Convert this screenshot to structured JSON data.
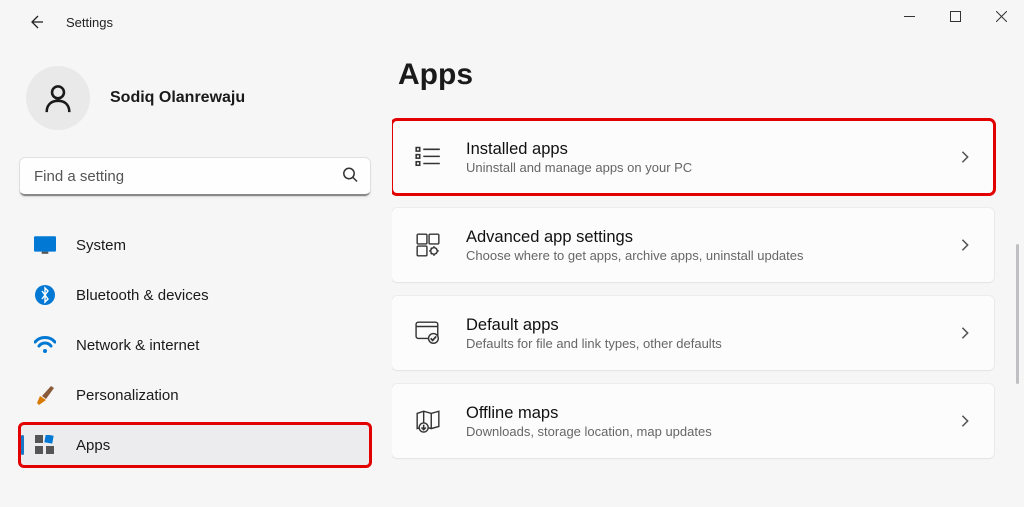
{
  "window": {
    "title": "Settings"
  },
  "profile": {
    "name": "Sodiq Olanrewaju"
  },
  "search": {
    "placeholder": "Find a setting"
  },
  "sidebar": {
    "items": [
      {
        "id": "system",
        "label": "System",
        "active": false,
        "highlight": false
      },
      {
        "id": "bluetooth",
        "label": "Bluetooth & devices",
        "active": false,
        "highlight": false
      },
      {
        "id": "network",
        "label": "Network & internet",
        "active": false,
        "highlight": false
      },
      {
        "id": "personalization",
        "label": "Personalization",
        "active": false,
        "highlight": false
      },
      {
        "id": "apps",
        "label": "Apps",
        "active": true,
        "highlight": true
      }
    ]
  },
  "page": {
    "title": "Apps",
    "cards": [
      {
        "id": "installed",
        "title": "Installed apps",
        "subtitle": "Uninstall and manage apps on your PC",
        "highlight": true
      },
      {
        "id": "advanced",
        "title": "Advanced app settings",
        "subtitle": "Choose where to get apps, archive apps, uninstall updates",
        "highlight": false
      },
      {
        "id": "default",
        "title": "Default apps",
        "subtitle": "Defaults for file and link types, other defaults",
        "highlight": false
      },
      {
        "id": "offlinemaps",
        "title": "Offline maps",
        "subtitle": "Downloads, storage location, map updates",
        "highlight": false
      }
    ]
  }
}
